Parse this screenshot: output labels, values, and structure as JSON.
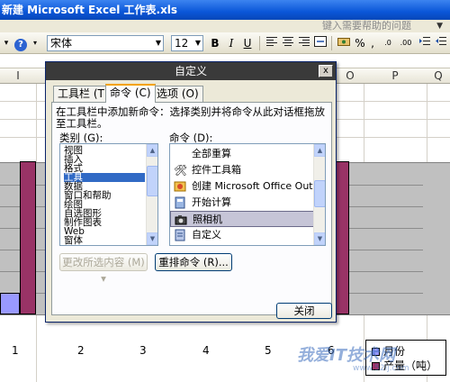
{
  "window": {
    "title": "新建 Microsoft Excel 工作表.xls",
    "help_placeholder": "键入需要帮助的问题"
  },
  "toolbar": {
    "font_name": "宋体",
    "font_size": "12",
    "bold": "B",
    "italic": "I",
    "underline": "U",
    "percent": "%",
    "comma": ","
  },
  "sheet": {
    "columns": [
      "I",
      "O",
      "P",
      "Q"
    ],
    "x_ticks": [
      "1",
      "2",
      "3",
      "4",
      "5",
      "6"
    ]
  },
  "chart_data": {
    "type": "bar",
    "categories": [
      "1",
      "2",
      "3",
      "4",
      "5",
      "6"
    ],
    "series": [
      {
        "name": "月份",
        "values": [
          1,
          2,
          3,
          4,
          5,
          6
        ]
      },
      {
        "name": "产量（吨）",
        "values": [
          null,
          null,
          null,
          null,
          null,
          null
        ]
      }
    ],
    "legend": "right"
  },
  "dialog": {
    "title": "自定义",
    "close": "x",
    "tabs": [
      {
        "label": "工具栏 (T)",
        "active": false
      },
      {
        "label": "命令 (C)",
        "active": true
      },
      {
        "label": "选项 (O)",
        "active": false
      }
    ],
    "instruction": "在工具栏中添加新命令：选择类别并将命令从此对话框拖放至工具栏。",
    "category_label": "类别 (G):",
    "command_label": "命令 (D):",
    "categories": [
      "视图",
      "插入",
      "格式",
      "工具",
      "数据",
      "窗口和帮助",
      "绘图",
      "自选图形",
      "制作图表",
      "Web",
      "窗体"
    ],
    "selected_category": "工具",
    "commands": [
      {
        "label": "全部重算",
        "icon": "blank-icon"
      },
      {
        "label": "控件工具箱",
        "icon": "toolbox-icon"
      },
      {
        "label": "创建 Microsoft Office Outlook",
        "icon": "outlook-icon"
      },
      {
        "label": "开始计算",
        "icon": "calc-icon"
      },
      {
        "label": "照相机",
        "icon": "camera-icon"
      },
      {
        "label": "自定义",
        "icon": "customize-icon"
      }
    ],
    "selected_command": "照相机",
    "modify_selection_button": "更改所选内容 (M) ▾",
    "rearrange_button": "重排命令 (R)...",
    "close_button": "关闭"
  },
  "watermark": {
    "text": "我爱IT技术网",
    "sub": "www.52ij.com"
  }
}
